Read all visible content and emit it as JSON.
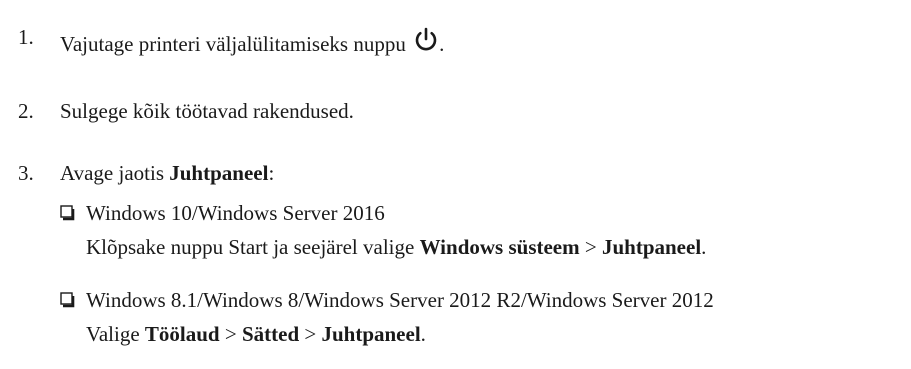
{
  "steps": [
    {
      "number": "1.",
      "text": "Vajutage printeri väljalülitamiseks nuppu",
      "icon": "power-icon",
      "suffix": "."
    },
    {
      "number": "2.",
      "text": "Sulgege kõik töötavad rakendused."
    },
    {
      "number": "3.",
      "text_before": "Avage jaotis ",
      "bold": "Juhtpaneel",
      "text_after": ":"
    }
  ],
  "options": [
    {
      "icon": "checkbox-icon",
      "title": "Windows 10/Windows Server 2016",
      "instruction_parts": [
        {
          "text": "Klõpsake nuppu Start ja seejärel valige ",
          "bold": false
        },
        {
          "text": "Windows süsteem",
          "bold": true
        },
        {
          "text": " > ",
          "bold": false
        },
        {
          "text": "Juhtpaneel",
          "bold": true
        },
        {
          "text": ".",
          "bold": false
        }
      ]
    },
    {
      "icon": "checkbox-icon",
      "title": "Windows 8.1/Windows 8/Windows Server 2012 R2/Windows Server 2012",
      "instruction_parts": [
        {
          "text": "Valige ",
          "bold": false
        },
        {
          "text": "Töölaud",
          "bold": true
        },
        {
          "text": " > ",
          "bold": false
        },
        {
          "text": "Sätted",
          "bold": true
        },
        {
          "text": " > ",
          "bold": false
        },
        {
          "text": "Juhtpaneel",
          "bold": true
        },
        {
          "text": ".",
          "bold": false
        }
      ]
    }
  ]
}
